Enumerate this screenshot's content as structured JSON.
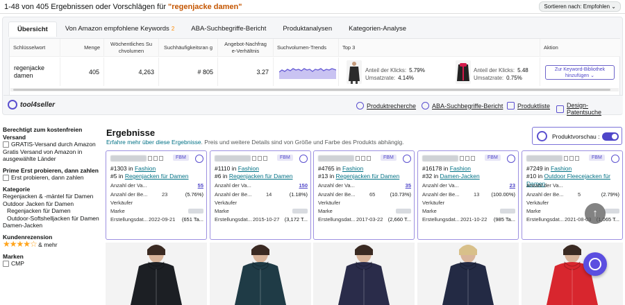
{
  "topbar": {
    "results_prefix": "1-48 von 405 Ergebnissen oder Vorschlägen für ",
    "query": "\"regenjacke damen\"",
    "sort_label": "Sortieren nach: Empfohlen"
  },
  "tabs": [
    {
      "label": "Übersicht"
    },
    {
      "label": "Von Amazon empfohlene Keywords",
      "badge": "2"
    },
    {
      "label": "ABA-Suchbegriffe-Bericht"
    },
    {
      "label": "Produktanalysen"
    },
    {
      "label": "Kategorien-Analyse"
    }
  ],
  "table": {
    "headers": [
      "Schlüsselwort",
      "Menge",
      "Wöchentliches Suchvolumen",
      "Suchhäufigkeitsrang",
      "Angebot-Nachfrage-Verhältnis",
      "Suchvolumen-Trends",
      "Top 3",
      "Aktion"
    ],
    "header_display": [
      "Schlüsselwort",
      "Menge",
      "Wöchentliches Su chvolumen",
      "Suchhäufigkeitsran g",
      "Angebot-Nachfrag e-Verhältnis",
      "Suchvolumen-Trends",
      "Top 3",
      "Aktion"
    ],
    "row": {
      "keyword": "regenjacke damen",
      "menge": "405",
      "weekly_volume": "4,263",
      "rank": "# 805",
      "ratio": "3.27"
    },
    "top3": [
      {
        "click_label": "Anteil der Klicks:",
        "click_value": "5.79%",
        "conv_label": "Umsatzrate:",
        "conv_value": "4.14%"
      },
      {
        "click_label": "Anteil der Klicks:",
        "click_value": "5.48",
        "conv_label": "Umsatzrate:",
        "conv_value": "0.75%"
      }
    ],
    "action_label": "Zur Keyword-Bibliothek hinzufügen",
    "action_chevron": "⌄"
  },
  "brand": {
    "name": "tool4seller",
    "links": [
      "Produktrecherche",
      "ABA-Suchbegriffe-Bericht",
      "Produktliste",
      "Design-Patentsuche"
    ]
  },
  "sidebar": {
    "free_shipping_heading": "Berechtigt zum kostenfreien Versand",
    "free_shipping_option": "GRATIS-Versand durch Amazon",
    "free_shipping_note": "Gratis Versand von Amazon in ausgewählte Länder",
    "prime_heading": "Prime Erst probieren, dann zahlen",
    "prime_option": "Erst probieren, dann zahlen",
    "category_heading": "Kategorie",
    "categories": [
      "Regenjacken & -mäntel für Damen",
      "Outdoor Jacken für Damen",
      "Regenjacken für Damen",
      "Outdoor-Softshelljacken für Damen",
      "Damen-Jacken"
    ],
    "review_heading": "Kundenrezension",
    "stars": "★★★★☆",
    "stars_suffix": "& mehr",
    "brand_heading": "Marken",
    "brand_option": "CMP"
  },
  "results": {
    "title": "Ergebnisse",
    "sub_link": "Erfahre mehr über diese Ergebnisse",
    "sub_text": ". Preis und weitere Details sind von Größe und Farbe des Produkts abhängig.",
    "preview_label": "Produktvorschau :"
  },
  "cards": [
    {
      "fbm": "FBM",
      "rank1": "#1303",
      "cat1": "Fashion",
      "rank2": "#5",
      "cat2": "Regenjacken für Damen",
      "variants_label": "Anzahl der Va...",
      "variants": "55",
      "reviews_label": "Anzahl der Be...",
      "reviews": "23",
      "reviews_pct": "(5.76%)",
      "seller_label": "Verkäufer",
      "brand_label": "Marke",
      "created_label": "Erstellungsdat...",
      "created": "2022-09-21",
      "days": "(651 Ta..."
    },
    {
      "fbm": "FBM",
      "rank1": "#1110",
      "cat1": "Fashion",
      "rank2": "#6",
      "cat2": "Regenjacken für Damen",
      "variants_label": "Anzahl der Va...",
      "variants": "150",
      "reviews_label": "Anzahl der Be...",
      "reviews": "14",
      "reviews_pct": "(1.18%)",
      "seller_label": "Verkäufer",
      "brand_label": "Marke",
      "created_label": "Erstellungsdat...",
      "created": "2015-10-27",
      "days": "(3,172 T..."
    },
    {
      "fbm": "FBM",
      "rank1": "#4765",
      "cat1": "Fashion",
      "rank2": "#13",
      "cat2": "Regenjacken für Damen",
      "variants_label": "Anzahl der Va...",
      "variants": "35",
      "reviews_label": "Anzahl der Be...",
      "reviews": "65",
      "reviews_pct": "(10.73%)",
      "seller_label": "Verkäufer",
      "brand_label": "Marke",
      "created_label": "Erstellungsdat...",
      "created": "2017-03-22",
      "days": "(2,660 T..."
    },
    {
      "fbm": "FBM",
      "rank1": "#16178",
      "cat1": "Fashion",
      "rank2": "#32",
      "cat2": "Damen-Jacken",
      "variants_label": "Anzahl der Va...",
      "variants": "23",
      "reviews_label": "Anzahl der Be...",
      "reviews": "13",
      "reviews_pct": "(100.00%)",
      "seller_label": "Verkäufer",
      "brand_label": "Marke",
      "created_label": "Erstellungsdat...",
      "created": "2021-10-22",
      "days": "(985 Ta..."
    },
    {
      "fbm": "FBM",
      "rank1": "#7249",
      "cat1": "Fashion",
      "rank2": "#10",
      "cat2": "Outdoor Fleecejacken für Damen",
      "variants_label": "Anzahl der Va...",
      "variants": "",
      "reviews_label": "Anzahl der Be...",
      "reviews": "5",
      "reviews_pct": "(2.79%)",
      "seller_label": "Verkäufer",
      "brand_label": "Marke",
      "created_label": "Erstellungsdat...",
      "created": "2021-08-03",
      "days": "(1,065 T..."
    }
  ],
  "product_colors": [
    "#1c1f24",
    "#1f3b46",
    "#2a2c4a",
    "#232a44",
    "#d8262e"
  ],
  "accent": "#5a4fcf",
  "fab_icon": "tool4seller-fab-icon",
  "scrolltop_icon": "arrow-up-icon"
}
